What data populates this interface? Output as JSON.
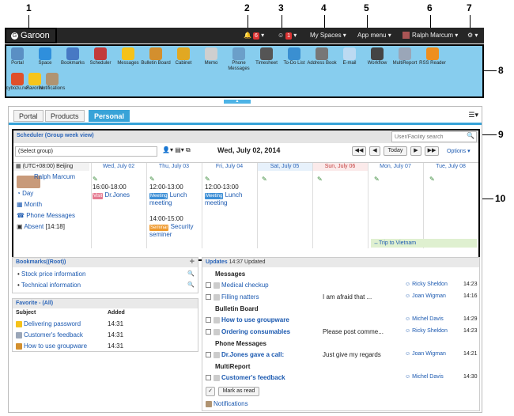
{
  "callouts": [
    "1",
    "2",
    "3",
    "4",
    "5",
    "6",
    "7",
    "8",
    "9",
    "10"
  ],
  "topbar": {
    "logo": "Garoon",
    "notify_count": "6",
    "presence_count": "1",
    "my_spaces": "My Spaces",
    "app_menu": "App menu",
    "user": "Ralph Marcum"
  },
  "apps": [
    {
      "label": "Portal",
      "color": "#5a8fc4"
    },
    {
      "label": "Space",
      "color": "#2f8fdc"
    },
    {
      "label": "Bookmarks",
      "color": "#4779c4"
    },
    {
      "label": "Scheduler",
      "color": "#c23b3b"
    },
    {
      "label": "Messages",
      "color": "#f5c21a"
    },
    {
      "label": "Bulletin Board",
      "color": "#d38f2e"
    },
    {
      "label": "Cabinet",
      "color": "#e1a822"
    },
    {
      "label": "Memo",
      "color": "#cfcfcf"
    },
    {
      "label": "Phone Messages",
      "color": "#6b9fc9"
    },
    {
      "label": "Timesheet",
      "color": "#555"
    },
    {
      "label": "To-Do List",
      "color": "#3a8fd1"
    },
    {
      "label": "Address Book",
      "color": "#777"
    },
    {
      "label": "E-mail",
      "color": "#bcdaf2"
    },
    {
      "label": "Workflow",
      "color": "#444"
    },
    {
      "label": "MultiReport",
      "color": "#9aa6b8"
    },
    {
      "label": "RSS Reader",
      "color": "#ef8f1f"
    },
    {
      "label": "cybozu.net",
      "color": "#e0502a"
    },
    {
      "label": "Favorite",
      "color": "#f7c51c"
    },
    {
      "label": "Notifications",
      "color": "#b09472"
    }
  ],
  "tabs": [
    "Portal",
    "Products",
    "Personal"
  ],
  "scheduler": {
    "title": "Scheduler (Group week view)",
    "search_placeholder": "User/Facility search",
    "group": "(Select group)",
    "date": "Wed, July 02, 2014",
    "today": "Today",
    "options": "Options",
    "timezone": "(UTC+08:00) Beijing",
    "days": [
      {
        "label": "Wed, July 02",
        "color": "#2a64b8"
      },
      {
        "label": "Thu, July 03",
        "color": "#2a64b8"
      },
      {
        "label": "Fri, July 04",
        "color": "#2a64b8"
      },
      {
        "label": "Sat, July 05",
        "color": "#2a64b8"
      },
      {
        "label": "Sun, July 06",
        "color": "#c23b3b"
      },
      {
        "label": "Mon, July 07",
        "color": "#2a64b8"
      },
      {
        "label": "Tue, July 08",
        "color": "#2a64b8"
      }
    ],
    "user": "Ralph Marcum",
    "links": [
      "Day",
      "Month",
      "Phone Messages"
    ],
    "absent": "Absent",
    "absent_time": "[14:18]",
    "events": [
      {
        "time": "16:00-18:00",
        "tag": "Visit",
        "title": "Dr.Jones",
        "tagcolor": "#e57b91"
      },
      {
        "time": "12:00-13:00",
        "tag": "Meeting",
        "title": "Lunch meeting",
        "tagcolor": "#3d8fd6"
      },
      {
        "time": "14:00-15:00",
        "tag": "Seminar",
        "title": "Security seminer",
        "tagcolor": "#ef9a2e"
      },
      {
        "time": "12:00-13:00",
        "tag": "Meeting",
        "title": "Lunch meeting",
        "tagcolor": "#3d8fd6"
      }
    ],
    "trip": "Trip to Vietnam"
  },
  "bookmarks": {
    "title": "Bookmarks((Root))",
    "items": [
      "Stock price information",
      "Technical information"
    ]
  },
  "favorite": {
    "title": "Favorite - (All)",
    "col_subject": "Subject",
    "col_added": "Added",
    "items": [
      {
        "subject": "Delivering password",
        "added": "14:31"
      },
      {
        "subject": "Customer's feedback",
        "added": "14:31"
      },
      {
        "subject": "How to use groupware",
        "added": "14:31"
      }
    ]
  },
  "updates": {
    "title": "Updates",
    "updated": "14:37 Updated",
    "groups": [
      {
        "name": "Messages",
        "items": [
          {
            "title": "Medical checkup",
            "snippet": "",
            "user": "Ricky Sheldon",
            "time": "14:23"
          },
          {
            "title": "Filling natters",
            "snippet": "I am afraid that ...",
            "user": "Joan Wigman",
            "time": "14:16"
          }
        ]
      },
      {
        "name": "Bulletin Board",
        "items": [
          {
            "title": "How to use groupware",
            "snippet": "",
            "user": "Michel Davis",
            "time": "14:29"
          },
          {
            "title": "Ordering consumables",
            "snippet": "Please post comme...",
            "user": "Ricky Sheldon",
            "time": "14:23"
          }
        ]
      },
      {
        "name": "Phone Messages",
        "items": [
          {
            "title": "Dr.Jones gave a call:",
            "snippet": "Just give my regards",
            "user": "Joan Wigman",
            "time": "14:21"
          }
        ]
      },
      {
        "name": "MultiReport",
        "items": [
          {
            "title": "Customer's feedback",
            "snippet": "",
            "user": "Michel Davis",
            "time": "14:30"
          }
        ]
      }
    ],
    "mark_read": "Mark as read",
    "notifications": "Notifications"
  }
}
